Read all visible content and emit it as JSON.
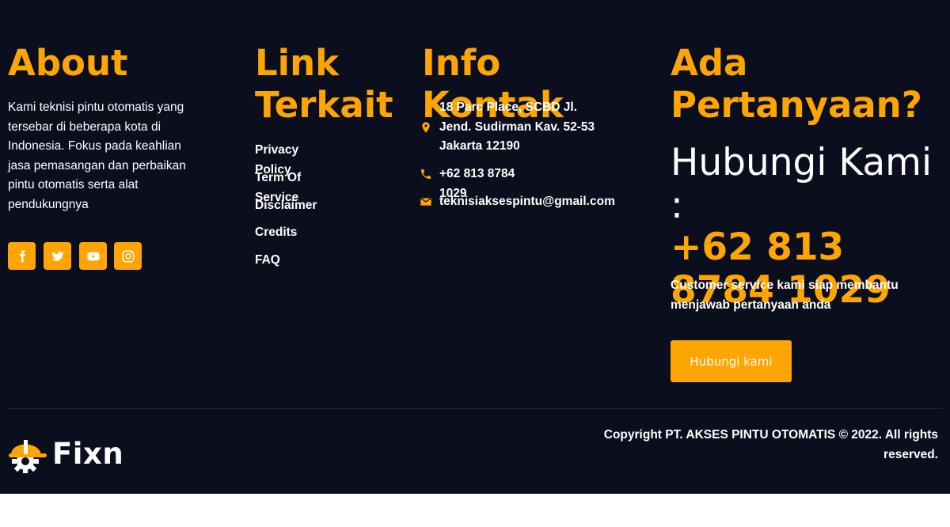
{
  "about": {
    "heading": "About",
    "description": "Kami teknisi pintu otomatis yang tersebar di beberapa kota di Indonesia. Fokus pada keahlian jasa pemasangan dan perbaikan pintu otomatis serta alat pendukungnya",
    "social": [
      {
        "icon": "facebook-icon"
      },
      {
        "icon": "twitter-icon"
      },
      {
        "icon": "youtube-icon"
      },
      {
        "icon": "instagram-icon"
      }
    ]
  },
  "links": {
    "heading": "Link Terkait",
    "items": [
      {
        "label": "Privacy Policy"
      },
      {
        "label": "Term Of Service"
      },
      {
        "label": "Disclaimer"
      },
      {
        "label": "Credits"
      },
      {
        "label": "FAQ"
      }
    ]
  },
  "contact": {
    "heading": "Info Kontak",
    "address": "18 Parc Place, SCBD Jl. Jend. Sudirman Kav. 52-53 Jakarta 12190",
    "phone": "+62 813 8784 1029",
    "email": "teknisiaksespintu@gmail.com"
  },
  "cta": {
    "heading": "Ada Pertanyaan?",
    "subheading": "Hubungi Kami :",
    "phone": "+62 813 8784 1029",
    "description": "Customer service kami siap membantu menjawab pertanyaan anda",
    "button_label": "Hubungi kami"
  },
  "bottom": {
    "logo_text": "Fixn",
    "copyright": "Copyright PT. AKSES PINTU OTOMATIS © 2022. All rights reserved."
  },
  "colors": {
    "background": "#0b0e1c",
    "accent": "#ffa500",
    "text": "#ffffff"
  }
}
